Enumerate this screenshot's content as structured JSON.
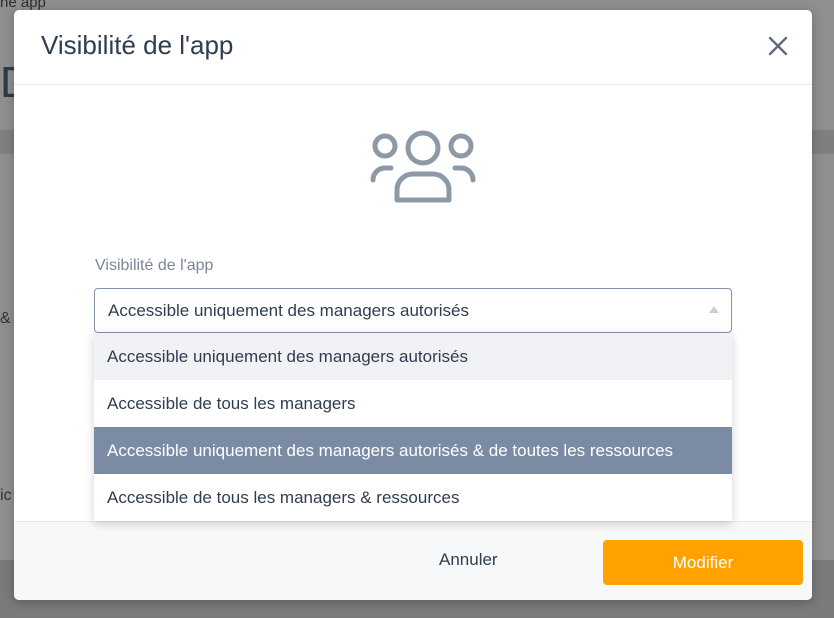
{
  "background": {
    "top_text": "ne app",
    "big_letter": "D",
    "amp_text": "&",
    "tic_text": "ic"
  },
  "modal": {
    "title": "Visibilité de l'app",
    "close_icon": "close-icon",
    "header_icon": "users-group-icon",
    "field": {
      "label": "Visibilité de l'app",
      "selected": "Accessible uniquement des managers autorisés"
    },
    "options": [
      {
        "label": "Accessible uniquement des managers autorisés",
        "state": "selected"
      },
      {
        "label": "Accessible de tous les managers",
        "state": "default"
      },
      {
        "label": "Accessible uniquement des managers autorisés & de toutes les ressources",
        "state": "hovered"
      },
      {
        "label": "Accessible de tous les managers & ressources",
        "state": "default"
      }
    ],
    "footer": {
      "cancel_label": "Annuler",
      "submit_label": "Modifier"
    }
  },
  "colors": {
    "accent": "#ffa200",
    "highlight": "#7a8ba3",
    "text": "#2f3d4f",
    "label": "#7b8798"
  }
}
